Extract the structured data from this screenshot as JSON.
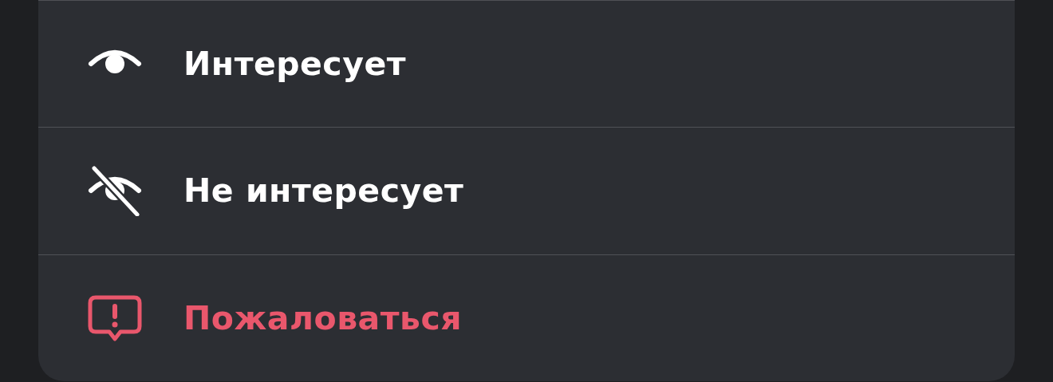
{
  "menu": {
    "items": [
      {
        "label": "Интересует",
        "kind": "normal"
      },
      {
        "label": "Не интересует",
        "kind": "normal"
      },
      {
        "label": "Пожаловаться",
        "kind": "destructive"
      }
    ]
  }
}
